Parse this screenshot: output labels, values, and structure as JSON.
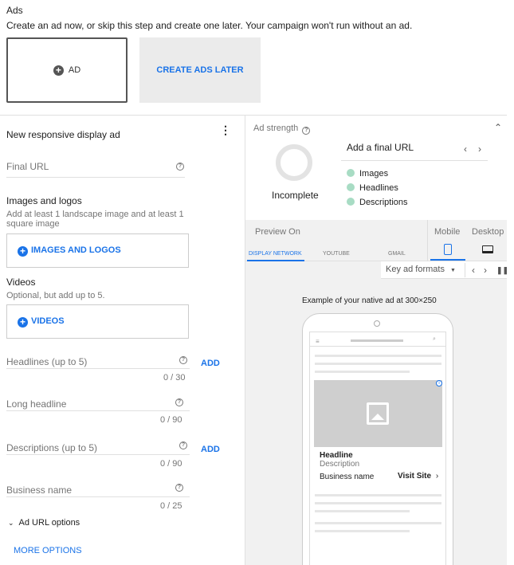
{
  "ads_section": {
    "title": "Ads",
    "description": "Create an ad now, or skip this step and create one later. Your campaign won't run without an ad.",
    "ad_button_label": "AD",
    "create_later_label": "CREATE ADS LATER"
  },
  "form": {
    "title": "New responsive display ad",
    "final_url_label": "Final URL",
    "images_title": "Images and logos",
    "images_desc": "Add at least 1 landscape image and at least 1 square image",
    "images_button": "IMAGES AND LOGOS",
    "videos_title": "Videos",
    "videos_desc": "Optional, but add up to 5.",
    "videos_button": "VIDEOS",
    "headlines_label": "Headlines (up to 5)",
    "headlines_count": "0 / 30",
    "add_label": "ADD",
    "long_headline_label": "Long headline",
    "long_headline_count": "0 / 90",
    "descriptions_label": "Descriptions (up to 5)",
    "descriptions_count": "0 / 90",
    "business_name_label": "Business name",
    "business_name_count": "0 / 25",
    "ad_url_options": "Ad URL options",
    "more_options": "MORE OPTIONS"
  },
  "ad_strength": {
    "title": "Ad strength",
    "status": "Incomplete",
    "final_url_prompt": "Add a final URL",
    "items": [
      "Images",
      "Headlines",
      "Descriptions"
    ]
  },
  "preview": {
    "label": "Preview On",
    "mobile": "Mobile",
    "desktop": "Desktop",
    "tabs": [
      "DISPLAY NETWORK",
      "YOUTUBE",
      "GMAIL"
    ],
    "formats": "Key ad formats",
    "example_caption": "Example of your native ad at 300×250",
    "ad_headline": "Headline",
    "ad_description": "Description",
    "ad_business": "Business name",
    "ad_cta": "Visit Site",
    "ad_info": "i"
  },
  "colors": {
    "accent": "#1a73e8",
    "strength_dot": "#a8dcc4"
  }
}
